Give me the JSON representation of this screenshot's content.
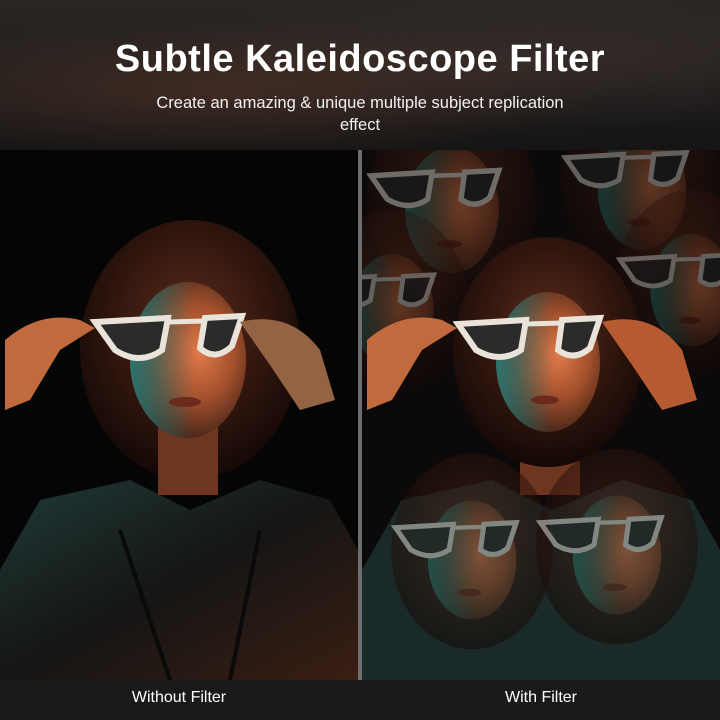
{
  "header": {
    "title": "Subtle Kaleidoscope Filter",
    "subtitle": "Create an amazing & unique multiple subject replication effect"
  },
  "comparison": {
    "left_label": "Without Filter",
    "right_label": "With Filter"
  },
  "colors": {
    "teal_light": "#2f8f86",
    "warm_light": "#c8643a",
    "background": "#050505"
  },
  "icons": []
}
